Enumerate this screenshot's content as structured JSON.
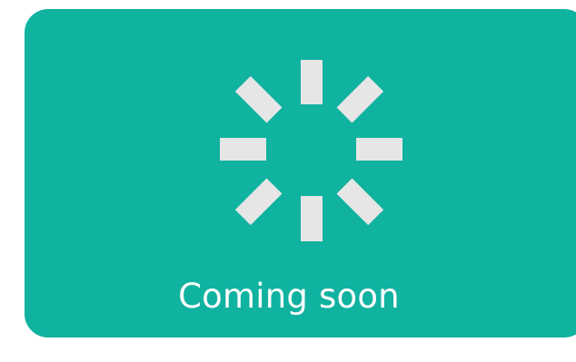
{
  "status": {
    "message": "Coming soon",
    "icon": "loading-spinner-icon"
  },
  "colors": {
    "card_background": "#10b2a0",
    "spinner": "#e6e6e6",
    "text": "#ffffff",
    "page_background": "#ffffff"
  }
}
